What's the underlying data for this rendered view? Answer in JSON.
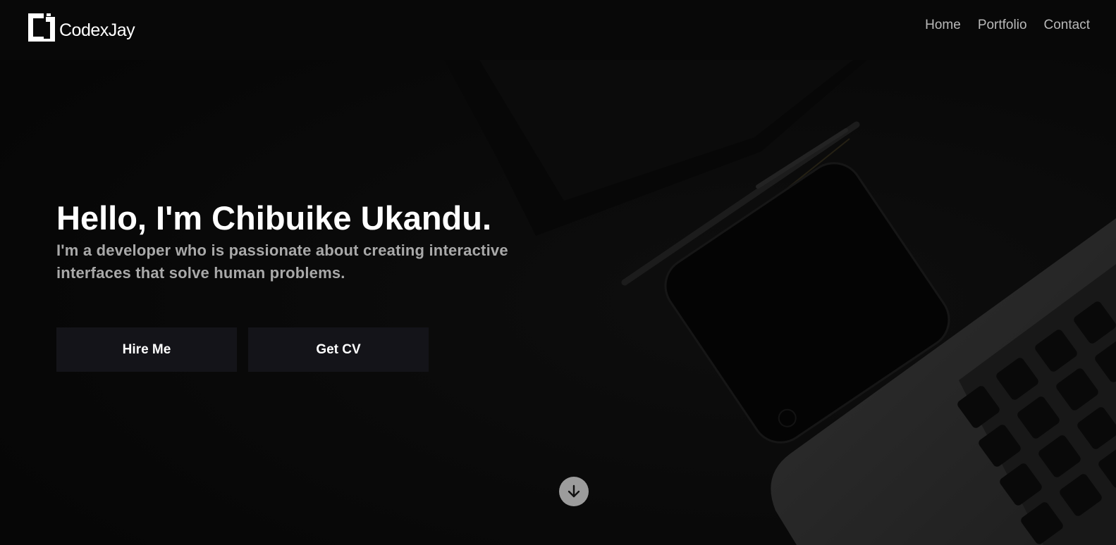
{
  "header": {
    "brand": "CodexJay",
    "nav": [
      {
        "label": "Home"
      },
      {
        "label": "Portfolio"
      },
      {
        "label": "Contact"
      }
    ]
  },
  "hero": {
    "title": "Hello, I'm Chibuike Ukandu.",
    "subtitle_line1": "I'm a developer who is passionate about creating interactive",
    "subtitle_line2": "interfaces that solve human problems.",
    "buttons": {
      "hire": "Hire Me",
      "cv": "Get CV"
    },
    "scroll_icon": "arrow-down-icon"
  },
  "colors": {
    "background": "#0d0d0d",
    "header": "#080808",
    "button": "#141419",
    "subtitle": "#a9a9a9",
    "scroll_button": "#9c9c9c"
  }
}
